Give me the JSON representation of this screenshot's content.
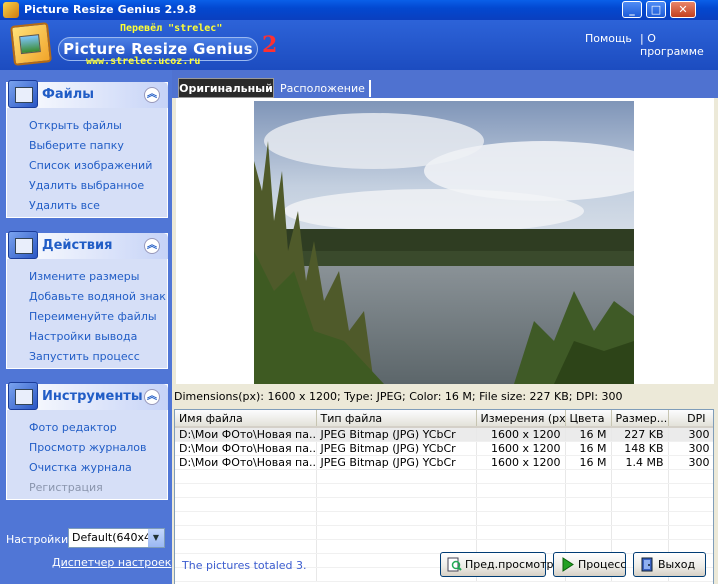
{
  "window": {
    "title": "Picture Resize Genius 2.9.8",
    "min": "_",
    "max": "□",
    "close": "✕"
  },
  "header": {
    "logo_name": "Picture Resize Genius",
    "logo_version": "2",
    "translator_line1": "Перевёл  \"strelec\"",
    "translator_line2": "www.strelec.ucoz.ru",
    "help_link": "Помощь",
    "about_link": "| О программе"
  },
  "sidebar": {
    "files": {
      "title": "Файлы",
      "items": [
        "Открыть файлы",
        "Выберите папку",
        "Список изображений",
        "Удалить выбранное",
        "Удалить все"
      ]
    },
    "actions": {
      "title": "Действия",
      "items": [
        "Измените размеры",
        "Добавьте водяной знак",
        "Переименуйте файлы",
        "Настройки вывода",
        "Запустить процесс"
      ]
    },
    "tools": {
      "title": "Инструменты",
      "items": [
        "Фото редактор",
        "Просмотр журналов",
        "Очистка журнала",
        "Регистрация"
      ]
    },
    "settings_label": "Настройки:",
    "settings_value": "Default(640x48",
    "settings_manager": "Диспетчер настроек"
  },
  "tabs": {
    "original": "Оригинальный",
    "layout": "Расположение"
  },
  "info": "Dimensions(px): 1600 x 1200; Type: JPEG; Color: 16 M; File size: 227 KB; DPI: 300",
  "table": {
    "headers": [
      "Имя файла",
      "Тип файла",
      "Измерения (px)",
      "Цвета",
      "Размер...",
      "DPI"
    ],
    "rows": [
      [
        "D:\\Мои ФОто\\Новая па...",
        "JPEG Bitmap (JPG) YCbCr",
        "1600 x 1200",
        "16 M",
        "227 KB",
        "300"
      ],
      [
        "D:\\Мои ФОто\\Новая па...",
        "JPEG Bitmap (JPG) YCbCr",
        "1600 x 1200",
        "16 M",
        "148 KB",
        "300"
      ],
      [
        "D:\\Мои ФОто\\Новая па...",
        "JPEG Bitmap (JPG) YCbCr",
        "1600 x 1200",
        "16 M",
        "1.4 MB",
        "300"
      ]
    ]
  },
  "status": "The pictures totaled 3.",
  "buttons": {
    "preview": "Пред.просмотр",
    "process": "Процесс",
    "exit": "Выход"
  }
}
